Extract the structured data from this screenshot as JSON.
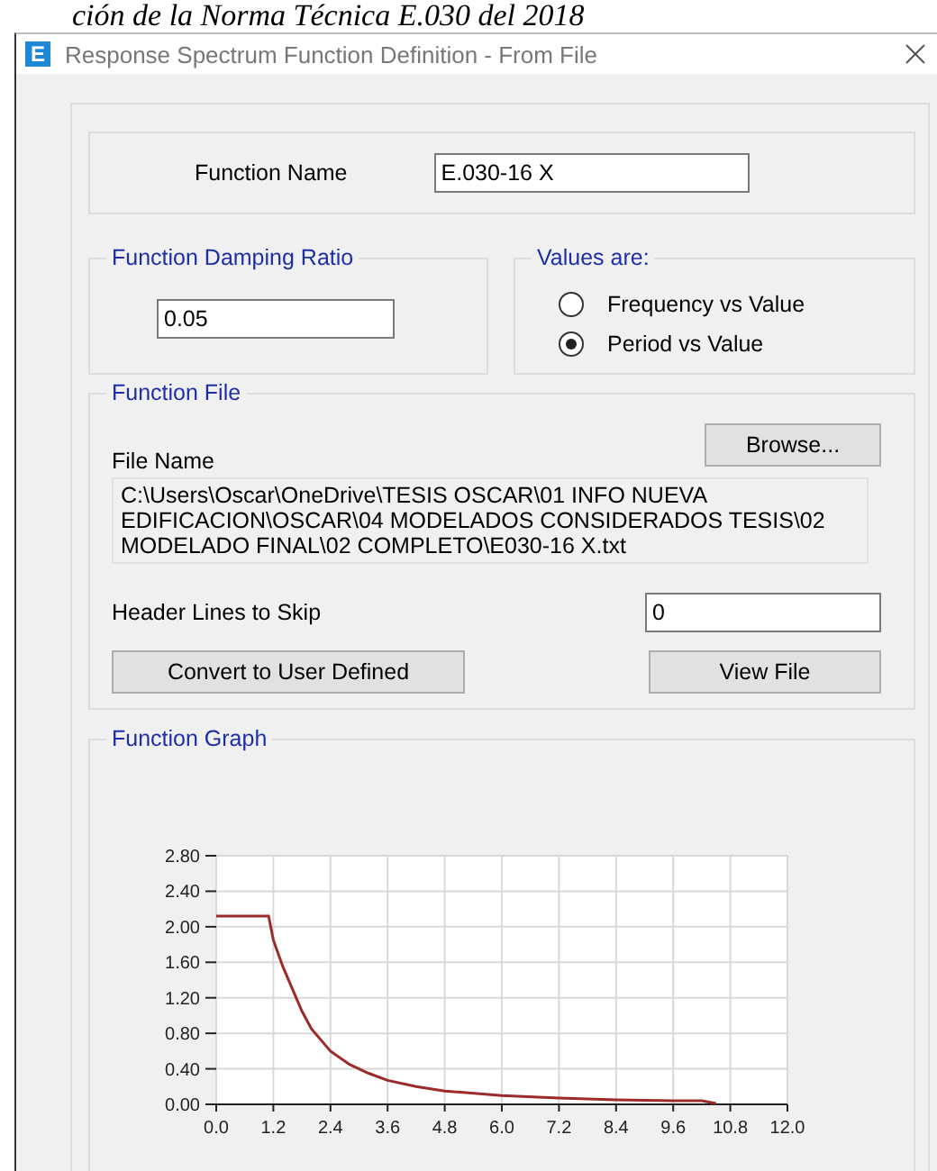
{
  "document_caption": "ción de la Norma Técnica E.030 del 2018",
  "window": {
    "app_icon": "E",
    "title": "Response Spectrum Function Definition - From File"
  },
  "function_name": {
    "label": "Function Name",
    "value": "E.030-16 X"
  },
  "damping": {
    "title": "Function Damping Ratio",
    "value": "0.05"
  },
  "values_are": {
    "title": "Values are:",
    "options": [
      {
        "label": "Frequency vs Value",
        "selected": false
      },
      {
        "label": "Period vs Value",
        "selected": true
      }
    ]
  },
  "function_file": {
    "title": "Function File",
    "browse": "Browse...",
    "file_name_label": "File Name",
    "file_name": "C:\\Users\\Oscar\\OneDrive\\TESIS OSCAR\\01 INFO NUEVA EDIFICACION\\OSCAR\\04 MODELADOS CONSIDERADOS TESIS\\02 MODELADO FINAL\\02 COMPLETO\\E030-16 X.txt",
    "header_lines_label": "Header Lines to Skip",
    "header_lines": "0",
    "convert": "Convert to User Defined",
    "view": "View File"
  },
  "function_graph": {
    "title": "Function Graph",
    "chart_data": {
      "type": "line",
      "x": [
        0,
        1.1,
        1.2,
        1.4,
        1.6,
        1.8,
        2.0,
        2.4,
        2.8,
        3.2,
        3.6,
        4.2,
        4.8,
        6.0,
        7.2,
        8.4,
        9.6,
        10.2,
        10.5
      ],
      "grid": true,
      "series": [
        {
          "color": "#9b2a2a",
          "values": [
            2.12,
            2.12,
            1.85,
            1.55,
            1.3,
            1.05,
            0.85,
            0.6,
            0.45,
            0.35,
            0.27,
            0.2,
            0.15,
            0.1,
            0.07,
            0.05,
            0.04,
            0.04,
            0.01
          ]
        }
      ],
      "xlim": [
        0,
        12
      ],
      "ylim": [
        0,
        2.8
      ],
      "xticks": [
        {
          "value": 0,
          "label": "0.0"
        },
        {
          "value": 1.2,
          "label": "1.2"
        },
        {
          "value": 2.4,
          "label": "2.4"
        },
        {
          "value": 3.6,
          "label": "3.6"
        },
        {
          "value": 4.8,
          "label": "4.8"
        },
        {
          "value": 6,
          "label": "6.0"
        },
        {
          "value": 7.2,
          "label": "7.2"
        },
        {
          "value": 8.4,
          "label": "8.4"
        },
        {
          "value": 9.6,
          "label": "9.6"
        },
        {
          "value": 10.8,
          "label": "10.8"
        },
        {
          "value": 12,
          "label": "12.0"
        }
      ],
      "yticks": [
        {
          "value": 0,
          "label": "0.00"
        },
        {
          "value": 0.4,
          "label": "0.40"
        },
        {
          "value": 0.8,
          "label": "0.80"
        },
        {
          "value": 1.2,
          "label": "1.20"
        },
        {
          "value": 1.6,
          "label": "1.60"
        },
        {
          "value": 2,
          "label": "2.00"
        },
        {
          "value": 2.4,
          "label": "2.40"
        },
        {
          "value": 2.8,
          "label": "2.80"
        }
      ]
    }
  }
}
